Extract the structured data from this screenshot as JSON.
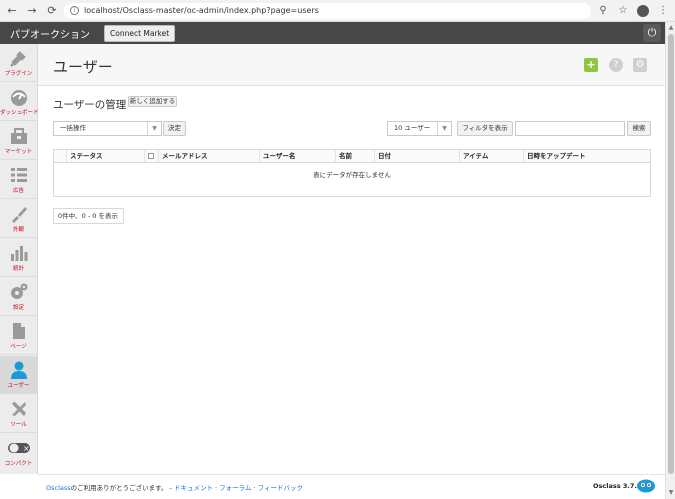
{
  "browser": {
    "url": "localhost/Osclass-master/oc-admin/index.php?page=users"
  },
  "appbar": {
    "title": "パブオークション",
    "market_button": "Connect Market"
  },
  "sidebar": {
    "items": [
      {
        "label": "プラグイン",
        "icon": "plugin-icon"
      },
      {
        "label": "ダッシュボード",
        "icon": "dashboard-icon"
      },
      {
        "label": "マーケット",
        "icon": "market-icon"
      },
      {
        "label": "広告",
        "icon": "list-icon"
      },
      {
        "label": "外観",
        "icon": "appearance-icon"
      },
      {
        "label": "統計",
        "icon": "stats-icon"
      },
      {
        "label": "設定",
        "icon": "settings-icon"
      },
      {
        "label": "ページ",
        "icon": "page-icon"
      },
      {
        "label": "ユーザー",
        "icon": "user-icon"
      },
      {
        "label": "ツール",
        "icon": "tools-icon"
      },
      {
        "label": "コンパクト",
        "icon": "toggle-icon"
      }
    ],
    "active_index": 8
  },
  "page": {
    "title": "ユーザー",
    "section_title": "ユーザーの管理",
    "add_new": "新しく追加する",
    "bulk_action": "一括操作",
    "apply": "決定",
    "per_page": "10 ユーザー",
    "show_filter": "フィルタを表示",
    "search_placeholder": "",
    "search_button": "検索",
    "columns": [
      "ステータス",
      "",
      "メールアドレス",
      "ユーザー名",
      "名前",
      "日付",
      "アイテム",
      "日時をアップデート"
    ],
    "empty_message": "表にデータが存在しません",
    "pager_info": "0件中、0 - 0 を表示"
  },
  "footer": {
    "brand": "Osclass",
    "thanks": "のご利用ありがとうございます。 - ",
    "links": [
      "ドキュメント",
      "フォーラム",
      "フィードバック"
    ],
    "version": "Osclass 3.7.5"
  },
  "colors": {
    "accent_green": "#8dc63f",
    "sidebar_label": "#d0021b",
    "header_dark": "#474747"
  }
}
